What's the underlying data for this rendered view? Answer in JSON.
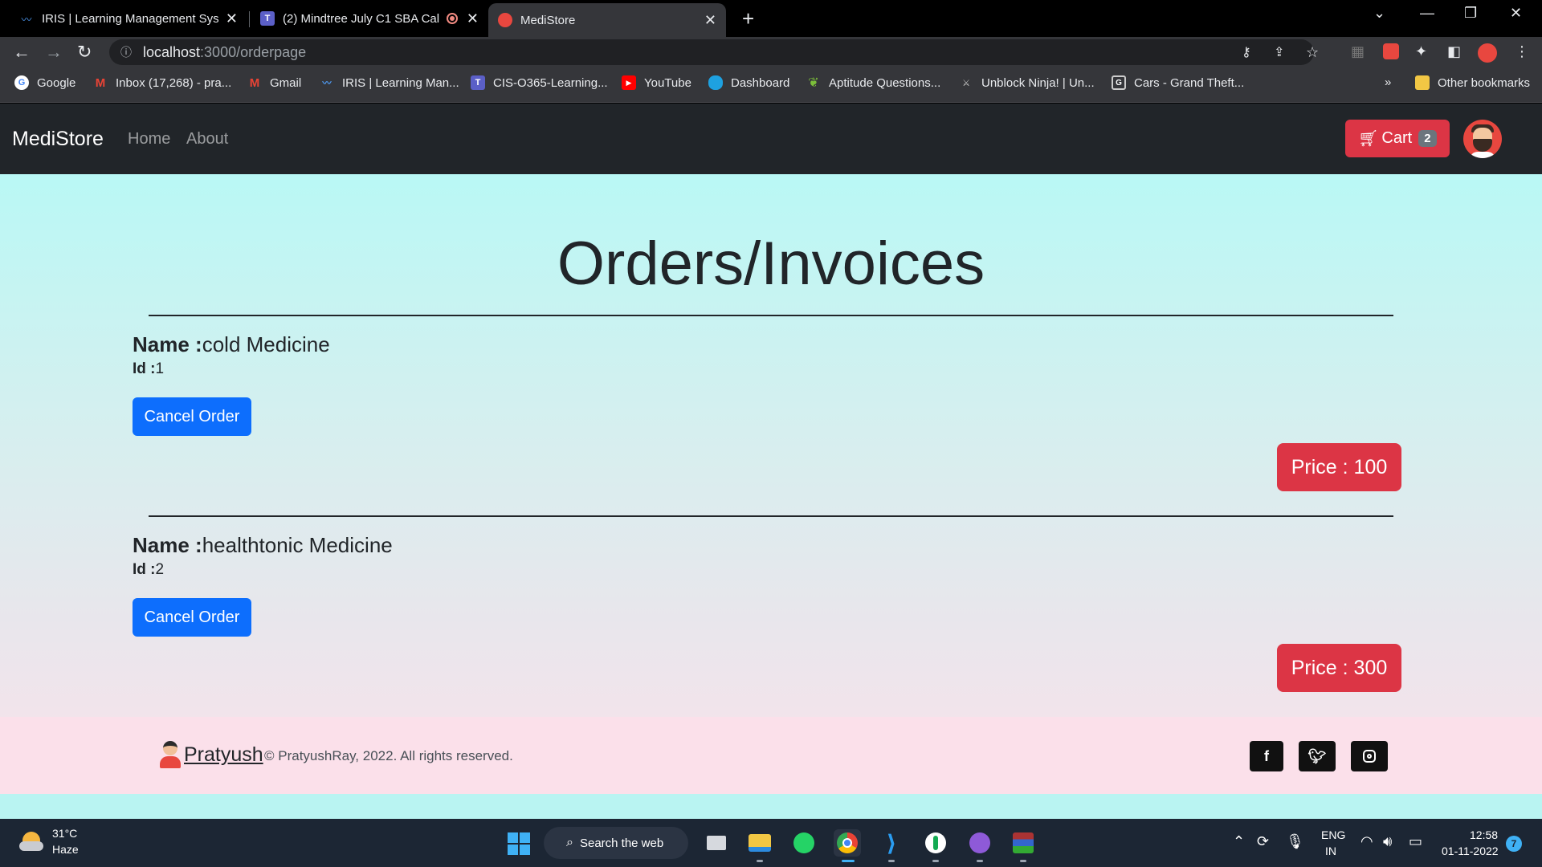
{
  "browser": {
    "tabs": [
      {
        "title": "IRIS | Learning Management Syst",
        "favicon": "iris-icon"
      },
      {
        "title": "(2) Mindtree July C1 SBA Call",
        "favicon": "teams-icon"
      },
      {
        "title": "MediStore",
        "favicon": "medistore-icon",
        "active": true
      }
    ],
    "url_host": "localhost",
    "url_path": ":3000/orderpage",
    "bookmarks": [
      {
        "label": "Google",
        "icon": "google-icon"
      },
      {
        "label": "Inbox (17,268) - pra...",
        "icon": "gmail-icon"
      },
      {
        "label": "Gmail",
        "icon": "gmail-icon"
      },
      {
        "label": "IRIS | Learning Man...",
        "icon": "iris-icon"
      },
      {
        "label": "CIS-O365-Learning...",
        "icon": "teams-icon"
      },
      {
        "label": "YouTube",
        "icon": "youtube-icon"
      },
      {
        "label": "Dashboard",
        "icon": "salesforce-icon"
      },
      {
        "label": "Aptitude Questions...",
        "icon": "leaf-icon"
      },
      {
        "label": "Unblock Ninja! | Un...",
        "icon": "ninja-icon"
      },
      {
        "label": "Cars - Grand Theft...",
        "icon": "g-icon"
      }
    ],
    "overflow": "»",
    "other_bookmarks": "Other bookmarks"
  },
  "navbar": {
    "brand": "MediStore",
    "links": [
      "Home",
      "About"
    ],
    "cart_label": "Cart",
    "cart_count": "2"
  },
  "page": {
    "title": "Orders/Invoices",
    "name_label": "Name :",
    "id_label": "Id :",
    "cancel_label": "Cancel Order",
    "price_label": "Price : ",
    "orders": [
      {
        "name": "cold Medicine",
        "id": "1",
        "price": "100"
      },
      {
        "name": "healthtonic Medicine",
        "id": "2",
        "price": "300"
      }
    ]
  },
  "footer": {
    "name": "Pratyush",
    "copyright": "© PratyushRay, 2022. All rights reserved.",
    "social": [
      "facebook-icon",
      "twitter-icon",
      "instagram-icon"
    ]
  },
  "taskbar": {
    "temperature": "31°C",
    "condition": "Haze",
    "search_placeholder": "Search the web",
    "lang_line1": "ENG",
    "lang_line2": "IN",
    "time": "12:58",
    "date": "01-11-2022",
    "notifications": "7"
  },
  "colors": {
    "navbar_bg": "#212529",
    "cart_red": "#dc3545",
    "cancel_blue": "#0d6efd",
    "content_top": "#b9f8f5",
    "footer_bg": "#fbe0ea"
  }
}
